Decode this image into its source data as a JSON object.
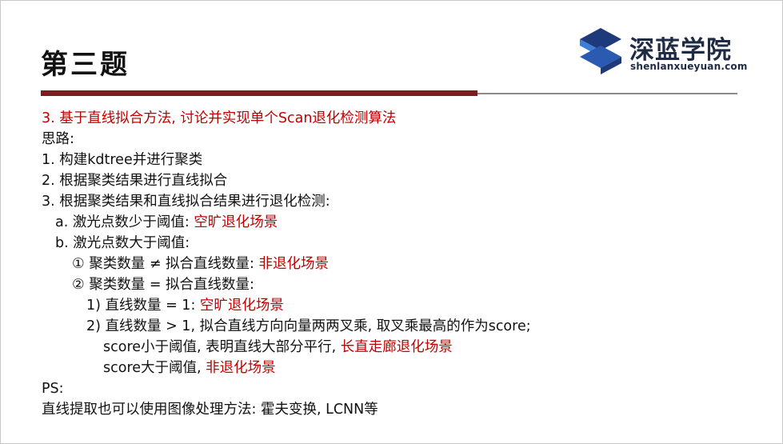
{
  "slide": {
    "title": "第三题",
    "logo": {
      "name_cn": "深蓝学院",
      "name_en": "shenlanxueyuan.com",
      "colors": {
        "primary": "#1f3a7a",
        "accent": "#3c7fd8"
      }
    },
    "colors": {
      "title_bar": "#7a1f1f",
      "highlight": "#c00000"
    },
    "lines": {
      "l1": "3. 基于直线拟合方法, 讨论并实现单个Scan退化检测算法",
      "l2": "思路:",
      "l3": "1. 构建kdtree并进行聚类",
      "l4": "2. 根据聚类结果进行直线拟合",
      "l5": "3. 根据聚类结果和直线拟合结果进行退化检测:",
      "l6a": "a. 激光点数少于阈值: ",
      "l6b": "空旷退化场景",
      "l7": "b. 激光点数大于阈值:",
      "l8a": "① 聚类数量 ≠ 拟合直线数量: ",
      "l8b": "非退化场景",
      "l9": "② 聚类数量 = 拟合直线数量:",
      "l10a": "1) 直线数量 = 1: ",
      "l10b": "空旷退化场景",
      "l11": "2) 直线数量 > 1, 拟合直线方向向量两两叉乘, 取叉乘最高的作为score;",
      "l12a": "score小于阈值, 表明直线大部分平行, ",
      "l12b": "长直走廊退化场景",
      "l13a": "score大于阈值, ",
      "l13b": "非退化场景",
      "l14": "PS:",
      "l15": "直线提取也可以使用图像处理方法: 霍夫变换, LCNN等"
    }
  }
}
